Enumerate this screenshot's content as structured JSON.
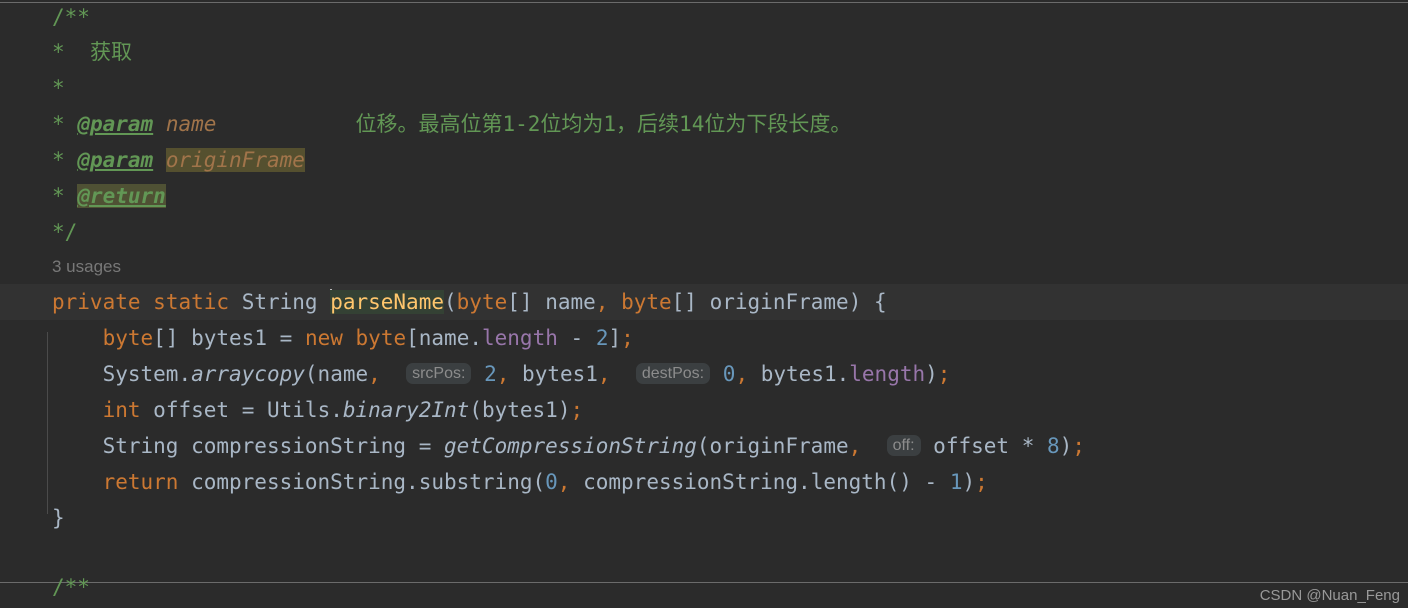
{
  "editor": {
    "theme": "darcula",
    "background": "#2b2b2b",
    "current_line_background": "#323232",
    "separator_color": "#6b6b6b",
    "colors": {
      "comment": "#629755",
      "keyword": "#cc7832",
      "identifier": "#a9b7c6",
      "method_declaration": "#ffc66d",
      "number": "#6897bb",
      "field": "#9876aa",
      "doc_param": "#a1744a",
      "inlay_hint_text": "#8c8c8c",
      "inlay_hint_bg": "#3b3f41",
      "usages_hint": "#787878",
      "identifier_highlight": "#344134",
      "warning_highlight": "#55502f",
      "caret": "#bbbbbb"
    }
  },
  "code": {
    "javadoc": {
      "open": "/**",
      "star": "*",
      "summary_text": "获取",
      "param1_tag": "@param",
      "param1_name": "name",
      "param1_desc": "位移。最高位第1-2位均为1，后续14位为下段长度。",
      "param2_tag": "@param",
      "param2_name": "originFrame",
      "return_tag": "@return",
      "close": "*/"
    },
    "usages_hint": "3 usages",
    "signature": {
      "modifier_private": "private",
      "modifier_static": "static",
      "return_type": "String",
      "method_name": "parseName",
      "open_paren": "(",
      "p1_type": "byte",
      "p1_brackets": "[]",
      "p1_name": "name",
      "comma": ",",
      "p2_type": "byte",
      "p2_brackets": "[]",
      "p2_name": "originFrame",
      "close_paren": ")",
      "open_brace": "{"
    },
    "line_bytes1": {
      "type": "byte",
      "brackets": "[]",
      "var": "bytes1",
      "eq": "=",
      "kw_new": "new",
      "new_type": "byte",
      "lbracket": "[",
      "obj": "name",
      "dot": ".",
      "field": "length",
      "minus": "-",
      "num": "2",
      "rbracket": "]",
      "semi": ";"
    },
    "line_arraycopy": {
      "class": "System",
      "dot": ".",
      "method": "arraycopy",
      "lparen": "(",
      "arg1": "name",
      "comma1": ",",
      "hint_srcpos": "srcPos:",
      "arg2": "2",
      "comma2": ",",
      "arg3": "bytes1",
      "comma3": ",",
      "hint_destpos": "destPos:",
      "arg4": "0",
      "comma4": ",",
      "arg5_obj": "bytes1",
      "arg5_dot": ".",
      "arg5_field": "length",
      "rparen": ")",
      "semi": ";"
    },
    "line_offset": {
      "type": "int",
      "var": "offset",
      "eq": "=",
      "class": "Utils",
      "dot": ".",
      "method": "binary2Int",
      "lparen": "(",
      "arg": "bytes1",
      "rparen": ")",
      "semi": ";"
    },
    "line_compression": {
      "type": "String",
      "var": "compressionString",
      "eq": "=",
      "method": "getCompressionString",
      "lparen": "(",
      "arg1": "originFrame",
      "comma": ",",
      "hint_off": "off:",
      "arg2": "offset",
      "star": "*",
      "num": "8",
      "rparen": ")",
      "semi": ";"
    },
    "line_return": {
      "kw": "return",
      "obj": "compressionString",
      "dot": ".",
      "method": "substring",
      "lparen": "(",
      "arg1": "0",
      "comma": ",",
      "arg2_obj": "compressionString",
      "arg2_dot": ".",
      "arg2_method": "length",
      "arg2_parens": "()",
      "minus": "-",
      "num": "1",
      "rparen": ")",
      "semi": ";"
    },
    "close_brace": "}",
    "next_javadoc_open": "/**"
  },
  "watermark": {
    "text": "CSDN @Nuan_Feng"
  }
}
